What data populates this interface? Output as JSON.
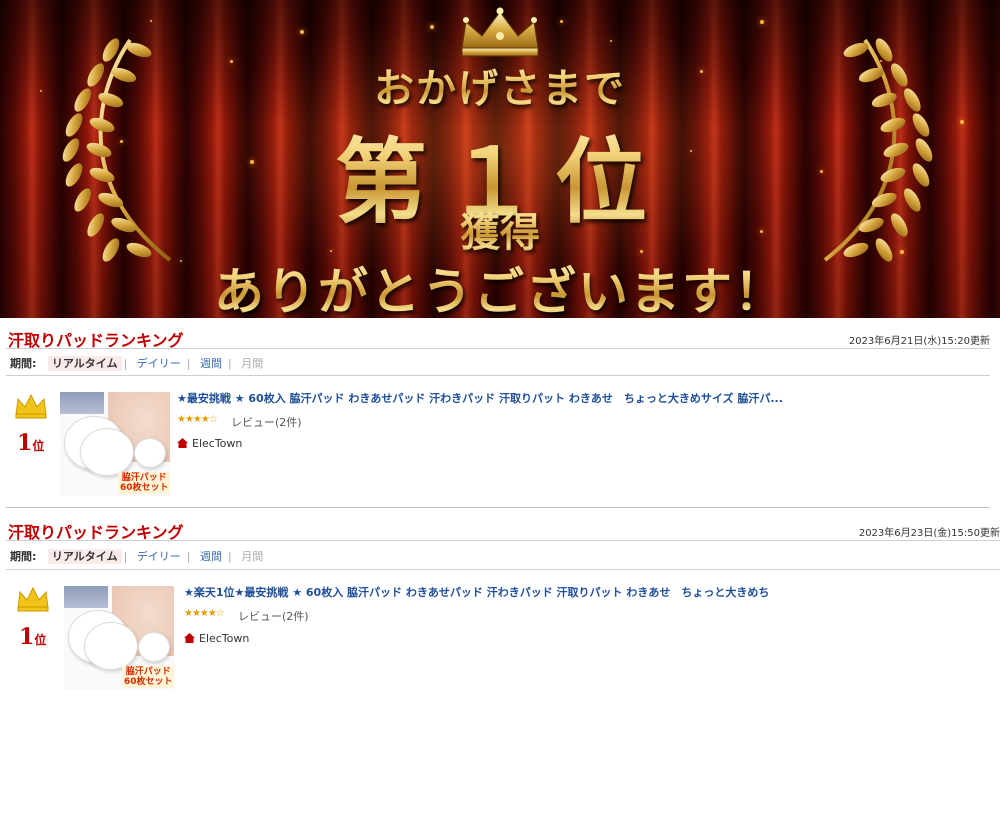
{
  "banner": {
    "line1": "おかげさまで",
    "line2": "第１位",
    "line3": "獲得",
    "line4": "ありがとうございます！",
    "icons": [
      "crown-icon",
      "laurel-icon"
    ],
    "colors": {
      "curtain": "#8e1609",
      "gold": "#e6c15c"
    }
  },
  "rankings": [
    {
      "title": "汗取りパッドランキング",
      "updated": "2023年6月21日(水)15:20更新",
      "period_label": "期間:",
      "tabs": [
        {
          "label": "リアルタイム",
          "state": "active"
        },
        {
          "label": "デイリー",
          "state": "link"
        },
        {
          "label": "週間",
          "state": "link"
        },
        {
          "label": "月間",
          "state": "off"
        }
      ],
      "rank": "1",
      "rank_suffix": "位",
      "thumb_caption_1": "脇汗パッド",
      "thumb_caption_2": "60枚セット",
      "product_title": "★最安挑戦 ★ 60枚入 脇汗パッド わきあせパッド 汗わきパッド 汗取りパット わきあせ　ちょっと大きめサイズ 脇汗パ...",
      "stars": "★★★★☆",
      "reviews": "レビュー(2件)",
      "shop": "ElecTown"
    },
    {
      "title": "汗取りパッドランキング",
      "updated": "2023年6月23日(金)15:50更新",
      "period_label": "期間:",
      "tabs": [
        {
          "label": "リアルタイム",
          "state": "active"
        },
        {
          "label": "デイリー",
          "state": "link"
        },
        {
          "label": "週間",
          "state": "link"
        },
        {
          "label": "月間",
          "state": "off"
        }
      ],
      "rank": "1",
      "rank_suffix": "位",
      "thumb_caption_1": "脇汗パッド",
      "thumb_caption_2": "60枚セット",
      "product_title": "★楽天1位★最安挑戦 ★ 60枚入 脇汗パッド わきあせパッド 汗わきパッド 汗取りパット わきあせ　ちょっと大きめち",
      "stars": "★★★★☆",
      "reviews": "レビュー(2件)",
      "shop": "ElecTown"
    }
  ]
}
